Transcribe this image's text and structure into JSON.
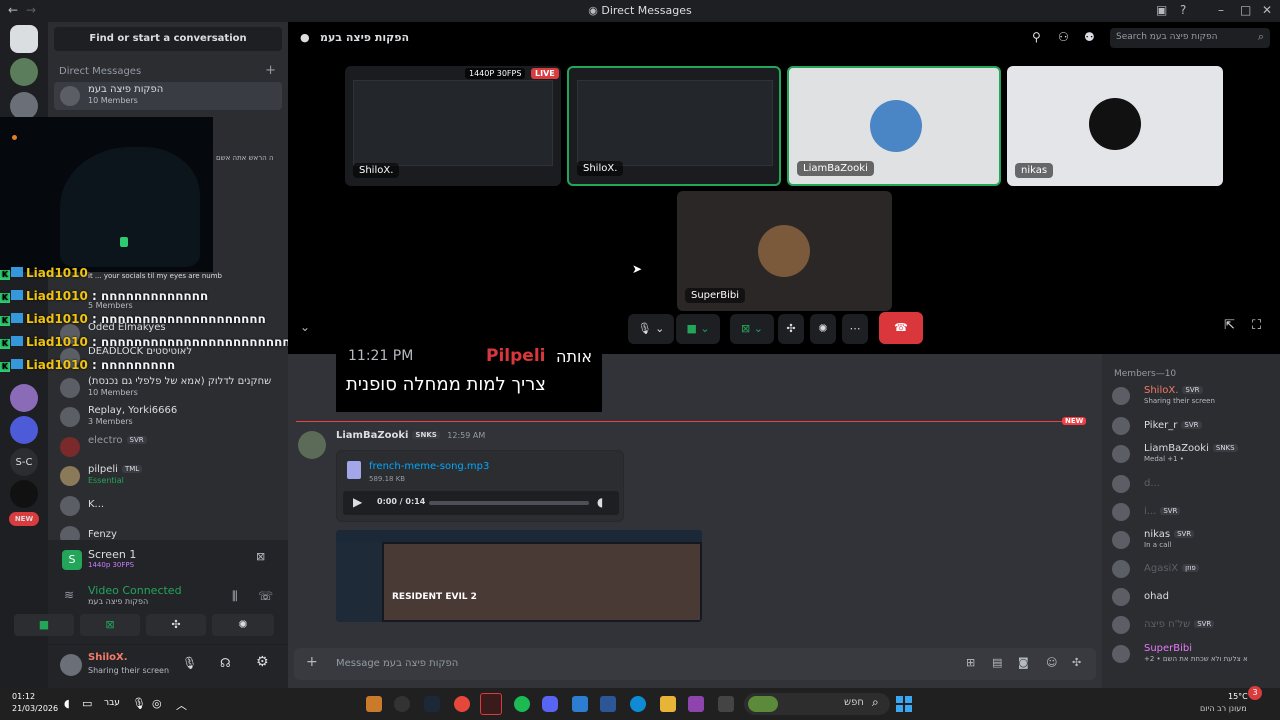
{
  "window": {
    "title": "Direct Messages"
  },
  "dm_panel": {
    "find_label": "Find or start a conversation",
    "header": "Direct Messages",
    "items": [
      {
        "name": "הפקות פיצה בעמ",
        "sub": "10 Members"
      },
      {
        "name": "Oded Elmakyes",
        "sub": ""
      },
      {
        "name": "DEADLOCK לאוטיסטים",
        "sub": ""
      },
      {
        "name": "שחקנים לדלוק (אמא של פלפלי גם נכנסת)",
        "sub": "10 Members"
      },
      {
        "name": "Replay, Yorki6666",
        "sub": "3 Members"
      },
      {
        "name": "electro",
        "sub": "",
        "tag": "SVR"
      },
      {
        "name": "pilpeli",
        "sub": "Essential",
        "tag": "TML"
      },
      {
        "name": "K...",
        "sub": ""
      },
      {
        "name": "Fenzy",
        "sub": ""
      }
    ],
    "snippet_members": "5 Members",
    "snippet_text": "ה הראש אתה אשם",
    "snippet_socials": "it ... your socials til my eyes are numb"
  },
  "chat_overlay": [
    {
      "user": "Liad1010",
      "text": ""
    },
    {
      "user": "Liad1010",
      "text": ": חחחחחחחחחחחחח"
    },
    {
      "user": "Liad1010",
      "text": ": חחחחחחחחחחחחחחחחחחחח"
    },
    {
      "user": "Liad1010",
      "text": ": חחחחחחחחחחחחחחחחחחחחחחחחחחחחחחח"
    },
    {
      "user": "Liad1010",
      "text": ": חחחחחחחחח"
    }
  ],
  "voice": {
    "screen_title": "Screen 1",
    "screen_quality": "1440p 30FPS",
    "status": "Video Connected",
    "channel": "הפקות פיצה בעמ",
    "user_name": "ShiloX.",
    "user_status": "Sharing their screen"
  },
  "stage": {
    "channel": "הפקות פיצה בעמ",
    "search_placeholder": "Search הפקות פיצה בעמ",
    "live_quality": "1440P 30FPS",
    "live_label": "LIVE",
    "tiles": [
      "ShiloX.",
      "ShiloX.",
      "LiamBaZooki",
      "nikas",
      "SuperBibi"
    ]
  },
  "chat": {
    "prev_time": "11:21 PM",
    "prev_author": "Pilpeli",
    "prev_text1": "אותה",
    "prev_text2": "צריך למות ממחלה סופנית",
    "new_label": "NEW",
    "msg_author": "LiamBaZooki",
    "msg_tag": "SNKS",
    "msg_time": "12:59 AM",
    "file_name": "french-meme-song.mp3",
    "file_size": "589.18 KB",
    "audio_time": "0:00 / 0:14",
    "audio_progress": 0,
    "embed_text": "RESIDENT EVIL 2",
    "composer_placeholder": "Message הפקות פיצה בעמ"
  },
  "members": {
    "header": "Members—10",
    "list": [
      {
        "name": "ShiloX.",
        "tag": "SVR",
        "status": "Sharing their screen",
        "color": "#f47b67"
      },
      {
        "name": "Piker_r",
        "tag": "SVR",
        "status": "",
        "color": "#dbdee1"
      },
      {
        "name": "LiamBaZooki",
        "tag": "SNKS",
        "status": "Medal +1 •",
        "color": "#dbdee1"
      },
      {
        "name": "d...",
        "tag": "",
        "status": "",
        "color": "#5d6067"
      },
      {
        "name": "i...",
        "tag": "SVR",
        "status": "",
        "color": "#5d6067"
      },
      {
        "name": "nikas",
        "tag": "SVR",
        "status": "In a call",
        "color": "#dbdee1"
      },
      {
        "name": "AgasiX",
        "tag": "פוזן",
        "status": "",
        "color": "#5d6067"
      },
      {
        "name": "ohad",
        "tag": "",
        "status": "",
        "color": "#dbdee1"
      },
      {
        "name": "של'ח פיצה",
        "tag": "SVR",
        "status": "",
        "color": "#5d6067"
      },
      {
        "name": "SuperBibi",
        "tag": "",
        "status": "+2 • א צלעת ולא שכחת את השם",
        "color": "#e879f9"
      }
    ]
  },
  "taskbar": {
    "time": "01:12",
    "date": "21/03/2026",
    "lang": "עבר",
    "search": "חפש",
    "weather_temp": "15°C",
    "weather_text": "מעונן רב היום",
    "badge": "3"
  }
}
